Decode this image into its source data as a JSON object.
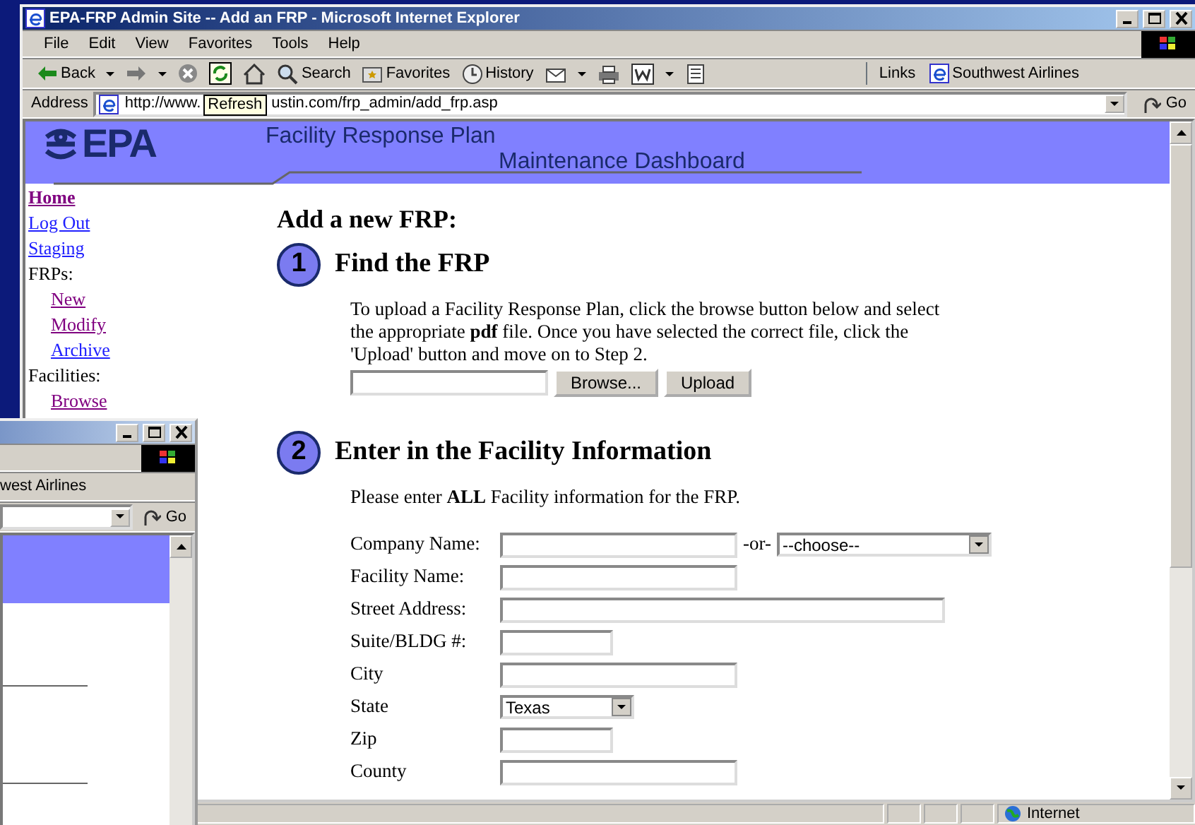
{
  "main_window": {
    "title": "EPA-FRP Admin Site -- Add an FRP - Microsoft Internet Explorer",
    "menu": [
      "File",
      "Edit",
      "View",
      "Favorites",
      "Tools",
      "Help"
    ],
    "toolbar": [
      {
        "kind": "back",
        "label": "Back",
        "dropdown": true
      },
      {
        "kind": "forward",
        "dropdown": true
      },
      {
        "kind": "stop",
        "dropdown": false
      },
      {
        "kind": "refresh",
        "dropdown": false
      },
      {
        "kind": "home",
        "dropdown": false
      },
      {
        "kind": "search",
        "label": "Search",
        "dropdown": false
      },
      {
        "kind": "favorites",
        "label": "Favorites",
        "dropdown": false
      },
      {
        "kind": "history",
        "label": "History",
        "dropdown": false
      },
      {
        "kind": "mail",
        "dropdown": true
      },
      {
        "kind": "print",
        "dropdown": false
      },
      {
        "kind": "edit",
        "dropdown": true
      },
      {
        "kind": "discuss",
        "dropdown": false
      }
    ],
    "links": {
      "label": "Links",
      "item": "Southwest Airlines"
    },
    "tooltip": "Refresh",
    "address": {
      "label": "Address",
      "url_start": "http://www.",
      "url_end": "ustin.com/frp_admin/add_frp.asp",
      "go": "Go"
    },
    "banner": {
      "logo": "EPA",
      "title": "Facility Response Plan",
      "subtitle": "Maintenance Dashboard"
    },
    "sidebar": [
      {
        "label": "Home",
        "kind": "link",
        "visited": true,
        "bold": true
      },
      {
        "label": "Log Out",
        "kind": "link",
        "visited": false
      },
      {
        "label": "Staging",
        "kind": "link",
        "visited": false
      },
      {
        "label": "FRPs:",
        "kind": "text",
        "children": [
          {
            "label": "New",
            "kind": "link",
            "visited": true
          },
          {
            "label": "Modify",
            "kind": "link",
            "visited": true
          },
          {
            "label": "Archive",
            "kind": "link",
            "visited": false
          }
        ]
      },
      {
        "label": "Facilities:",
        "kind": "text",
        "children": [
          {
            "label": "Browse",
            "kind": "link",
            "visited": true
          }
        ]
      }
    ],
    "heading": "Add a new FRP:",
    "steps": [
      {
        "number": "1",
        "title": "Find the FRP",
        "text": "To upload a Facility Response Plan, click the browse button below and select the appropriate **pdf** file. Once you have selected the correct file, click the 'Upload' button and move on to Step 2.",
        "browse": "Browse...",
        "upload": "Upload"
      },
      {
        "number": "2",
        "title": "Enter in the Facility Information",
        "text": "Please enter **ALL** Facility information for the FRP.",
        "fields": [
          {
            "label": "Company Name:",
            "kind": "medium",
            "or": "-or-",
            "choice": "--choose--"
          },
          {
            "label": "Facility Name:",
            "kind": "medium"
          },
          {
            "label": "Street Address:",
            "kind": "long"
          },
          {
            "label": "Suite/BLDG #:",
            "kind": "short"
          },
          {
            "label": "City",
            "kind": "medium"
          },
          {
            "label": "State",
            "kind": "select",
            "value": "Texas"
          },
          {
            "label": "Zip",
            "kind": "short"
          },
          {
            "label": "County",
            "kind": "medium"
          }
        ]
      }
    ],
    "status_bar": {
      "zone": "Internet"
    }
  },
  "back_window": {
    "links_item": "west Airlines",
    "go": "Go"
  }
}
